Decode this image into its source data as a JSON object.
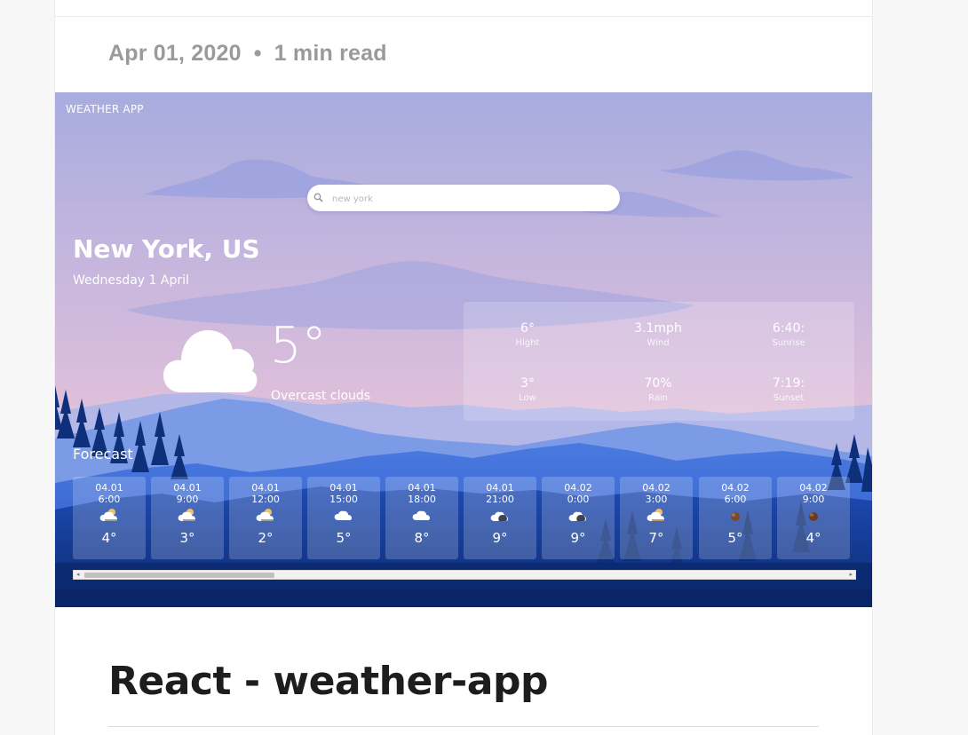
{
  "post": {
    "date": "Apr 01, 2020",
    "separator": "•",
    "read_time": "1 min read",
    "title": "React - weather-app"
  },
  "app": {
    "label": "WEATHER APP",
    "search": {
      "placeholder": "new york",
      "icon": "search-icon"
    },
    "city": "New York, US",
    "date": "Wednesday 1 April",
    "current": {
      "temp": "5°",
      "description": "Overcast clouds",
      "icon": "cloud-icon"
    },
    "stats": [
      {
        "value": "6°",
        "label": "Hight"
      },
      {
        "value": "3.1mph",
        "label": "Wind"
      },
      {
        "value": "6:40:",
        "label": "Sunrise"
      },
      {
        "value": "3°",
        "label": "Low"
      },
      {
        "value": "70%",
        "label": "Rain"
      },
      {
        "value": "7:19:",
        "label": "Sunset"
      }
    ],
    "forecast_title": "Forecast",
    "forecast": [
      {
        "date": "04.01",
        "time": "6:00",
        "temp": "4°",
        "icon": "sun-cloud-icon"
      },
      {
        "date": "04.01",
        "time": "9:00",
        "temp": "3°",
        "icon": "sun-cloud-icon"
      },
      {
        "date": "04.01",
        "time": "12:00",
        "temp": "2°",
        "icon": "sun-cloud-icon"
      },
      {
        "date": "04.01",
        "time": "15:00",
        "temp": "5°",
        "icon": "cloud-icon"
      },
      {
        "date": "04.01",
        "time": "18:00",
        "temp": "8°",
        "icon": "cloud-icon"
      },
      {
        "date": "04.01",
        "time": "21:00",
        "temp": "9°",
        "icon": "moon-cloud-icon"
      },
      {
        "date": "04.02",
        "time": "0:00",
        "temp": "9°",
        "icon": "moon-cloud-icon"
      },
      {
        "date": "04.02",
        "time": "3:00",
        "temp": "7°",
        "icon": "sun-cloud-icon"
      },
      {
        "date": "04.02",
        "time": "6:00",
        "temp": "5°",
        "icon": "dark-cloud-icon"
      },
      {
        "date": "04.02",
        "time": "9:00",
        "temp": "4°",
        "icon": "dark-cloud-icon"
      }
    ]
  },
  "colors": {
    "sky_top": "#a8acdf",
    "sky_bottom": "#e6c2d6",
    "mountain_far": "#8aa8ea",
    "mountain_near": "#3e6fdc",
    "forest": "#0e2f7a",
    "accent_text": "#ffffff"
  }
}
